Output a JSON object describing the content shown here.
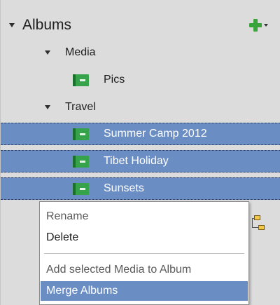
{
  "albums_panel": {
    "header": {
      "label": "Albums"
    },
    "tree": {
      "media": {
        "label": "Media",
        "albums": [
          {
            "label": "Pics"
          }
        ]
      },
      "travel": {
        "label": "Travel",
        "albums": [
          {
            "label": "Summer Camp 2012",
            "selected": true
          },
          {
            "label": "Tibet Holiday",
            "selected": true
          },
          {
            "label": "Sunsets",
            "selected": true
          }
        ]
      }
    }
  },
  "context_menu": {
    "items": [
      {
        "label": "Rename",
        "enabled": false
      },
      {
        "label": "Delete",
        "enabled": true
      },
      {
        "label": "Add selected Media to Album",
        "enabled": false
      },
      {
        "label": "Merge Albums",
        "enabled": true,
        "highlighted": true
      }
    ]
  },
  "colors": {
    "selection": "#6a8dc4",
    "album_icon": "#36a24a",
    "add_icon": "#3aa43a",
    "panel_bg": "#dcdcdc"
  },
  "icons": {
    "header_disclosure": "triangle-down",
    "add": "plus",
    "album": "green-album",
    "organize": "folder-tree"
  }
}
